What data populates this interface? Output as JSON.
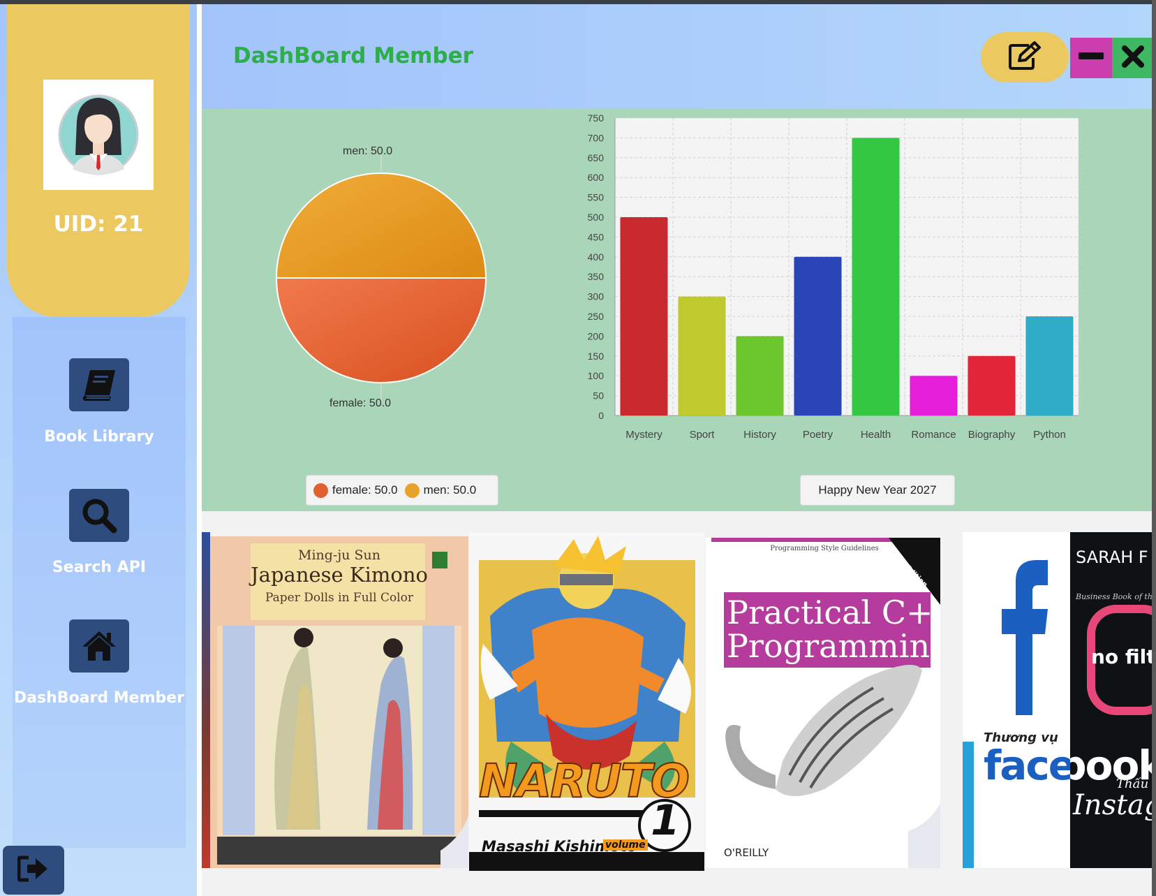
{
  "profile": {
    "uid_label": "UID: 21"
  },
  "nav": {
    "items": [
      {
        "label": "Book Library",
        "icon": "book-icon"
      },
      {
        "label": "Search API",
        "icon": "search-icon"
      },
      {
        "label": "DashBoard Member",
        "icon": "home-icon"
      }
    ],
    "logout_icon": "logout-icon"
  },
  "header": {
    "title": "DashBoard Member",
    "edit_icon": "edit-icon",
    "minimize_icon": "minimize-icon",
    "close_icon": "close-icon"
  },
  "colors": {
    "sidebar_card": "#ecc860",
    "title_green": "#2eae4a",
    "icon_tile": "#2e4d7e",
    "minimize": "#cc3db0",
    "close": "#3fb864",
    "chart_bg": "#a9d5b9"
  },
  "chart_data": [
    {
      "type": "pie",
      "slices": [
        {
          "label": "female: 50.0",
          "value": 50.0,
          "color": "#e2602f"
        },
        {
          "label": "men: 50.0",
          "value": 50.0,
          "color": "#e8a12a"
        }
      ],
      "legend": [
        "female: 50.0",
        "men: 50.0"
      ],
      "legend_placement": "bottom"
    },
    {
      "type": "bar",
      "categories": [
        "Mystery",
        "Sport",
        "History",
        "Poetry",
        "Health",
        "Romance",
        "Biography",
        "Python"
      ],
      "values": [
        500,
        300,
        200,
        400,
        700,
        100,
        150,
        250
      ],
      "colors": [
        "#c92a2f",
        "#c0ca2d",
        "#6cc72f",
        "#2a45b5",
        "#35c842",
        "#e51fd9",
        "#e3253a",
        "#2fadc7"
      ],
      "ylim": [
        0,
        750
      ],
      "yticks": [
        0,
        50,
        100,
        150,
        200,
        250,
        300,
        350,
        400,
        450,
        500,
        550,
        600,
        650,
        700,
        750
      ],
      "legend": "Happy New Year 2027",
      "legend_placement": "bottom",
      "grid": true
    }
  ],
  "books": [
    {
      "author": "Ming-ju Sun",
      "title": "Japanese Kimono",
      "subtitle": "Paper Dolls in Full Color"
    },
    {
      "title": "NARUTO",
      "volume": "1",
      "author": "Masashi Kishimoto",
      "badge": "volume"
    },
    {
      "series": "Programming Style Guidelines",
      "title": "Practical C++",
      "title2": "Programming",
      "corner": "2nd Edition",
      "publisher": "O'REILLY"
    },
    {
      "title_vi": "Thương vụ",
      "title": "facebook",
      "logo": "f"
    },
    {
      "author": "SARAH F",
      "tagline": "Business Book of the",
      "title": "no filt",
      "title2": "Instag",
      "sub": "Thấu"
    }
  ]
}
